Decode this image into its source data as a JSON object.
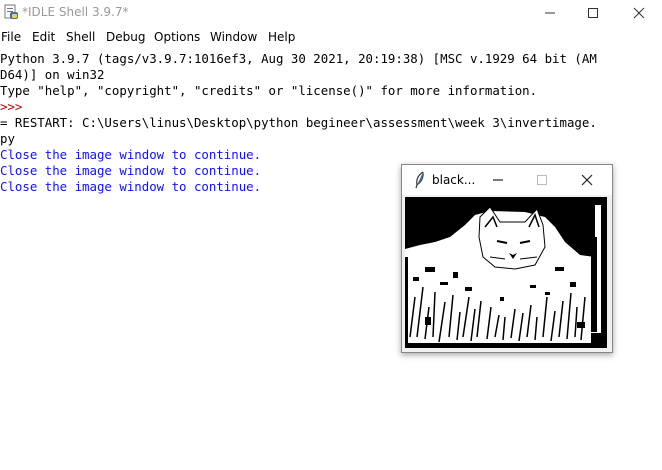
{
  "window": {
    "title": "*IDLE Shell 3.9.7*"
  },
  "menu": [
    "File",
    "Edit",
    "Shell",
    "Debug",
    "Options",
    "Window",
    "Help"
  ],
  "shell": {
    "lines": [
      "Python 3.9.7 (tags/v3.9.7:1016ef3, Aug 30 2021, 20:19:38) [MSC v.1929 64 bit (AM",
      "D64)] on win32",
      "Type \"help\", \"copyright\", \"credits\" or \"license()\" for more information.",
      ">>>",
      "= RESTART: C:\\Users\\linus\\Desktop\\python begineer\\assessment\\week 3\\invertimage.",
      "py",
      "Close the image window to continue.",
      "Close the image window to continue.",
      "Close the image window to continue."
    ]
  },
  "image_window": {
    "title": "black..."
  },
  "icons": {
    "app": "idle-python-icon",
    "minimize": "minimize-icon",
    "maximize": "maximize-icon",
    "close": "close-icon",
    "feather": "tk-feather-icon"
  }
}
